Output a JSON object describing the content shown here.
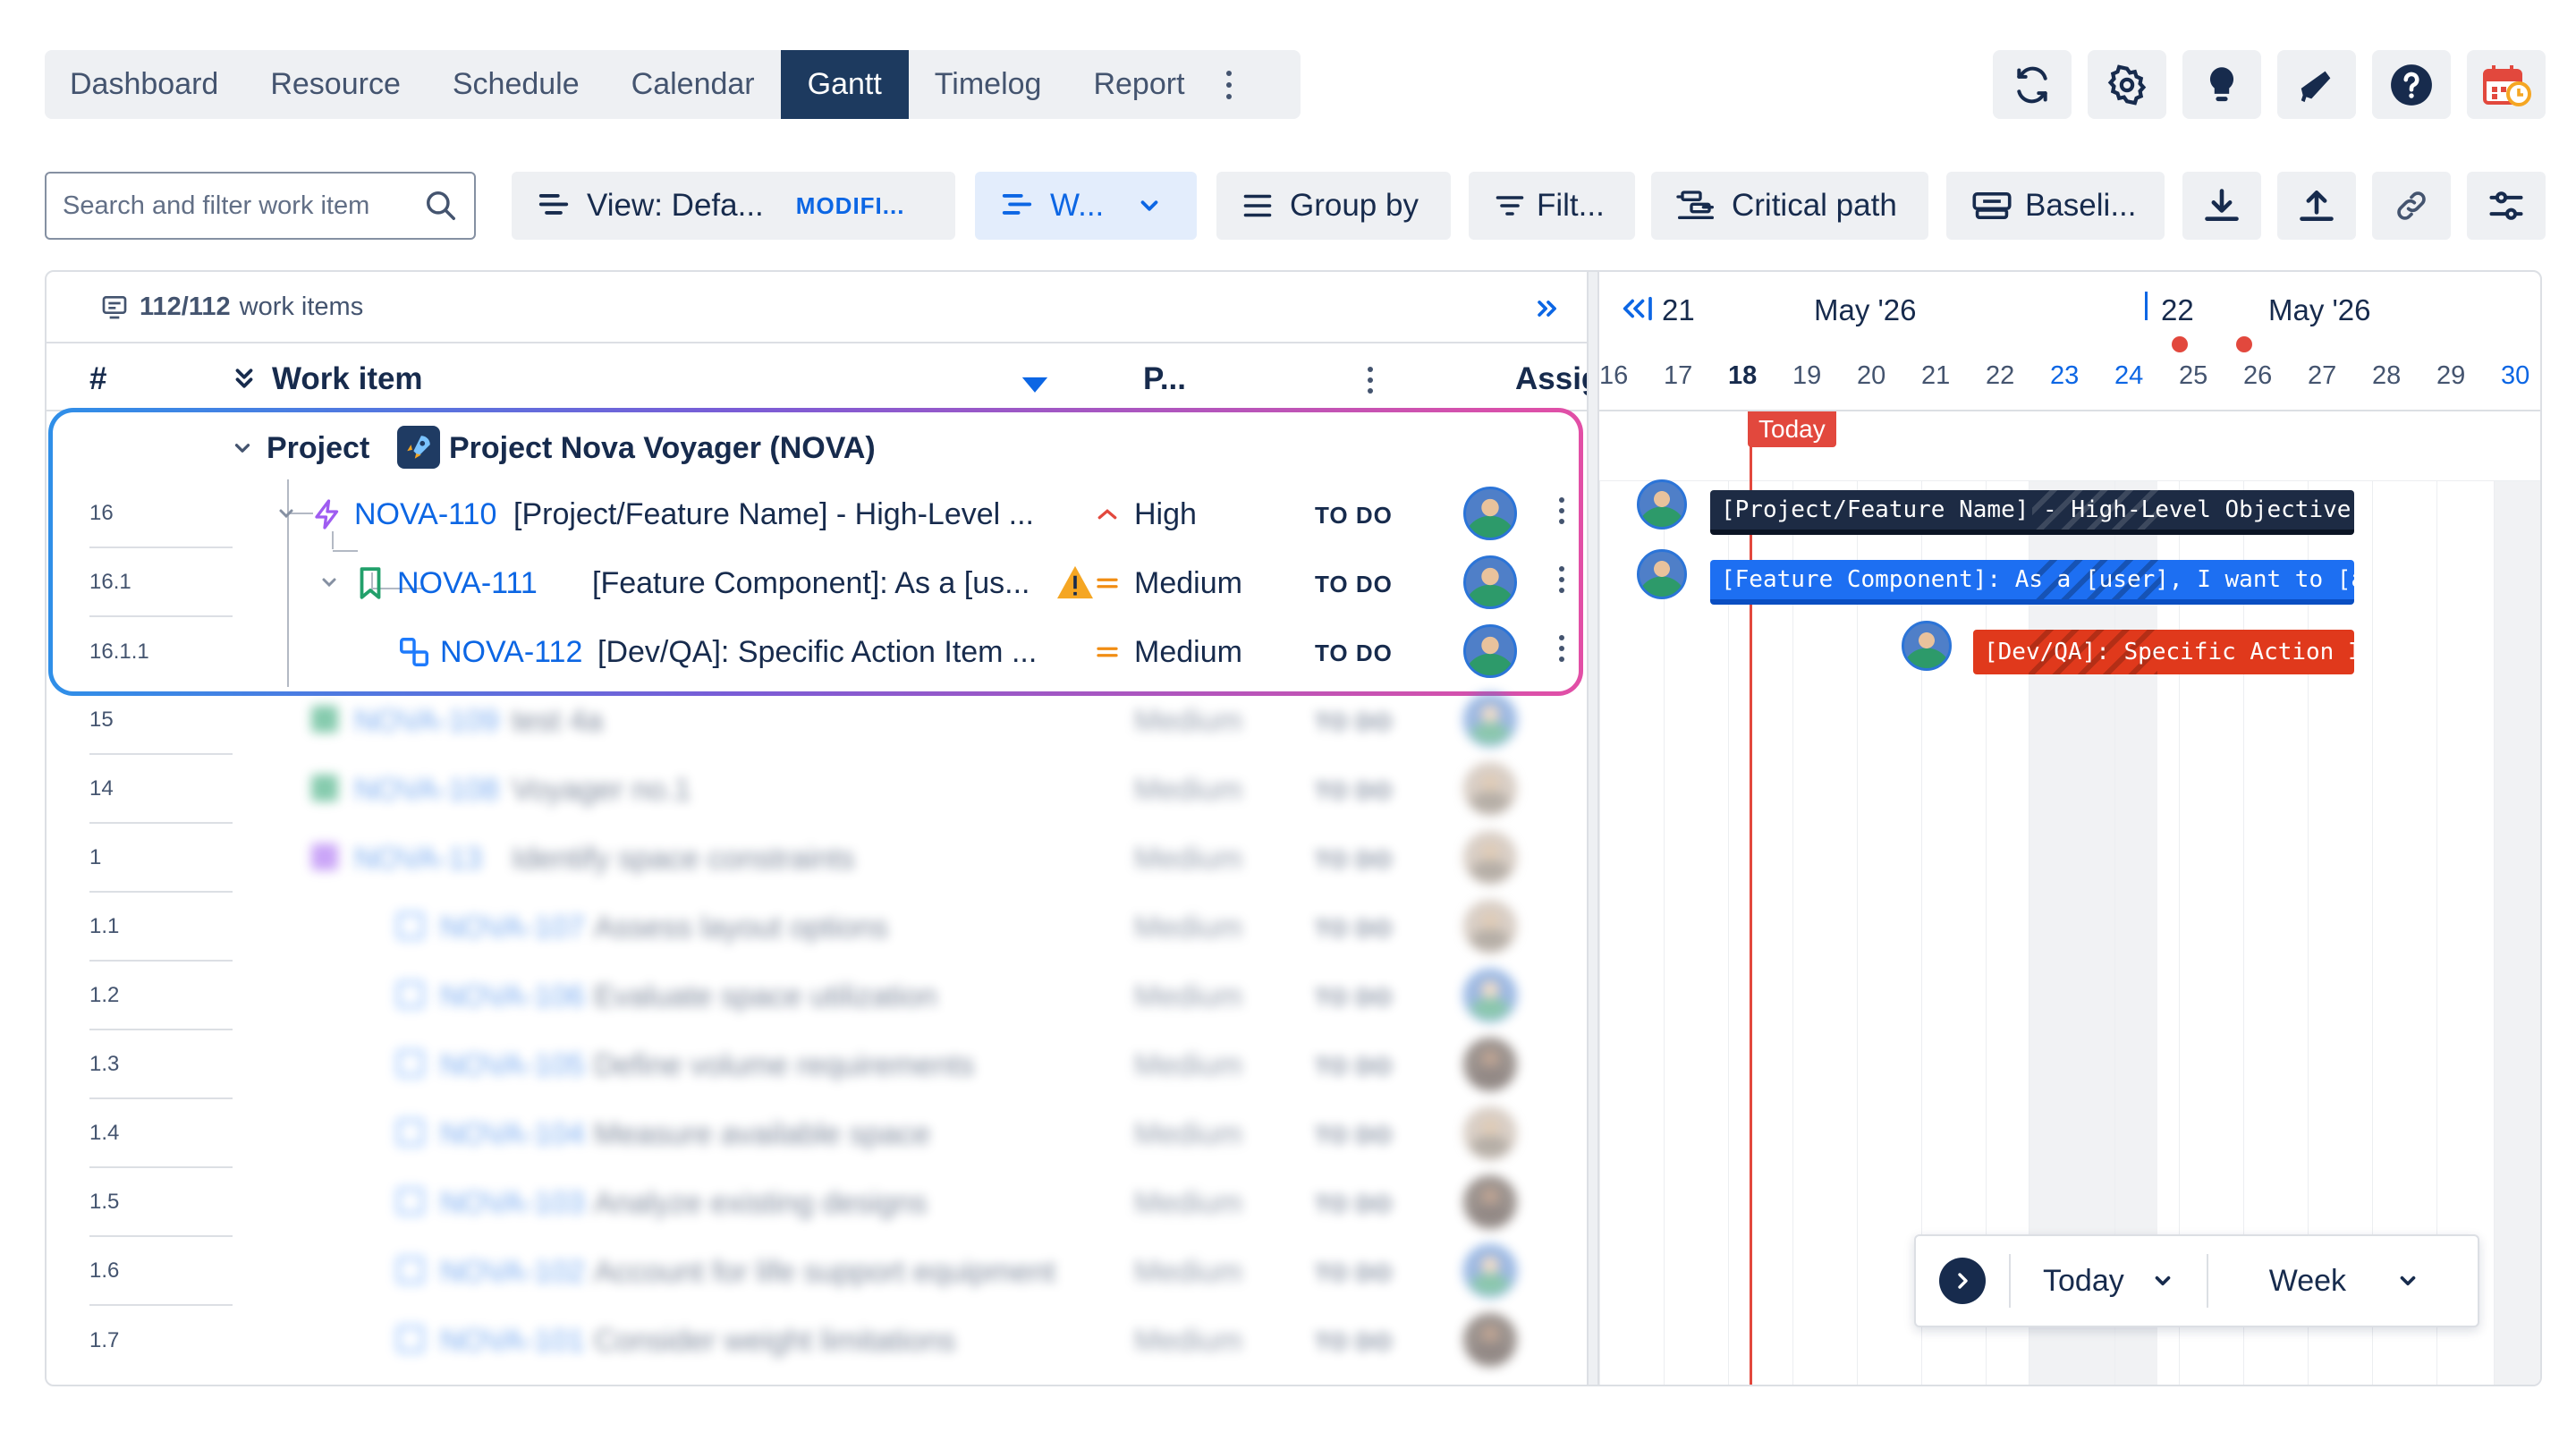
{
  "tabs": [
    {
      "label": "Dashboard",
      "active": false
    },
    {
      "label": "Resource",
      "active": false
    },
    {
      "label": "Schedule",
      "active": false
    },
    {
      "label": "Calendar",
      "active": false
    },
    {
      "label": "Gantt",
      "active": true
    },
    {
      "label": "Timelog",
      "active": false
    },
    {
      "label": "Report",
      "active": false
    }
  ],
  "header_icons": [
    "sync-icon",
    "gear-icon",
    "lightbulb-icon",
    "megaphone-icon",
    "help-icon",
    "calendar-clock-icon"
  ],
  "search": {
    "placeholder": "Search and filter work item",
    "value": ""
  },
  "toolbar": {
    "view_label": "View: Defa...",
    "view_badge": "MODIFI...",
    "w_label": "W...",
    "group_by_label": "Group by",
    "filter_label": "Filt...",
    "critical_path_label": "Critical path",
    "baseline_label": "Baseli..."
  },
  "list": {
    "count_value": "112/112",
    "count_label": "work items",
    "columns": {
      "num": "#",
      "work_item": "Work item",
      "priority": "P...",
      "assignee": "Assig"
    },
    "project_group": {
      "label": "Project",
      "name": "Project Nova Voyager (NOVA)"
    },
    "rows": [
      {
        "num": "16",
        "key": "NOVA-110",
        "title": "[Project/Feature Name] - High-Level ...",
        "priority": "High",
        "status": "TO DO"
      },
      {
        "num": "16.1",
        "key": "NOVA-111",
        "title": "[Feature Component]: As a [us...",
        "priority": "Medium",
        "status": "TO DO"
      },
      {
        "num": "16.1.1",
        "key": "NOVA-112",
        "title": "[Dev/QA]: Specific Action Item ...",
        "priority": "Medium",
        "status": "TO DO"
      },
      {
        "num": "15",
        "key": "NOVA-109",
        "title": "test 4a",
        "priority": "Medium",
        "status": "TO DO"
      },
      {
        "num": "14",
        "key": "NOVA-108",
        "title": "Voyager no.1",
        "priority": "Medium",
        "status": "TO DO"
      },
      {
        "num": "1",
        "key": "NOVA-13",
        "title": "Identify space constraints",
        "priority": "Medium",
        "status": "TO DO"
      },
      {
        "num": "1.1",
        "key": "NOVA-107",
        "title": "Assess layout options",
        "priority": "Medium",
        "status": "TO DO"
      },
      {
        "num": "1.2",
        "key": "NOVA-106",
        "title": "Evaluate space utilization",
        "priority": "Medium",
        "status": "TO DO"
      },
      {
        "num": "1.3",
        "key": "NOVA-105",
        "title": "Define volume requirements",
        "priority": "Medium",
        "status": "TO DO"
      },
      {
        "num": "1.4",
        "key": "NOVA-104",
        "title": "Measure available space",
        "priority": "Medium",
        "status": "TO DO"
      },
      {
        "num": "1.5",
        "key": "NOVA-103",
        "title": "Analyze existing designs",
        "priority": "Medium",
        "status": "TO DO"
      },
      {
        "num": "1.6",
        "key": "NOVA-102",
        "title": "Account for life support equipment",
        "priority": "Medium",
        "status": "TO DO"
      },
      {
        "num": "1.7",
        "key": "NOVA-101",
        "title": "Consider weight limitations",
        "priority": "Medium",
        "status": "TO DO"
      }
    ]
  },
  "gantt": {
    "week1_num": "21",
    "week1_month": "May '26",
    "week2_num": "22",
    "week2_month": "May '26",
    "days": [
      "16",
      "17",
      "18",
      "19",
      "20",
      "21",
      "22",
      "23",
      "24",
      "25",
      "26",
      "27",
      "28",
      "29",
      "30"
    ],
    "today_label": "Today",
    "bars": [
      {
        "label": "[Project/Feature Name] - High-Level Objective",
        "color": "#1d2b44"
      },
      {
        "label": "[Feature Component]: As a [user], I want to [action]",
        "color": "#1d6ff2"
      },
      {
        "label": "[Dev/QA]: Specific Action Ite...",
        "color": "#e0391c"
      }
    ],
    "controls": {
      "today": "Today",
      "scale": "Week"
    }
  },
  "colors": {
    "accent": "#0c66e4",
    "navy": "#1d3a5f",
    "today": "#e2483d",
    "warning": "#f5a623"
  }
}
